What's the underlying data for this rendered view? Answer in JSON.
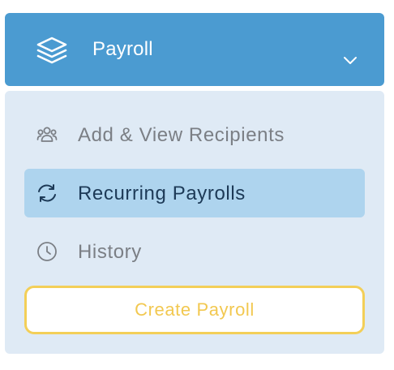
{
  "menu": {
    "title": "Payroll",
    "icon": "layers-icon",
    "expand_icon": "chevron-down-icon",
    "items": [
      {
        "label": "Add & View Recipients",
        "icon": "users-group-icon",
        "active": false
      },
      {
        "label": "Recurring Payrolls",
        "icon": "refresh-icon",
        "active": true
      },
      {
        "label": "History",
        "icon": "clock-icon",
        "active": false
      }
    ],
    "create_button": "Create Payroll"
  },
  "colors": {
    "header_bg": "#4b9bd1",
    "panel_bg": "#dfeaf5",
    "active_bg": "#aed4ee",
    "accent_yellow": "#f3cf58"
  }
}
